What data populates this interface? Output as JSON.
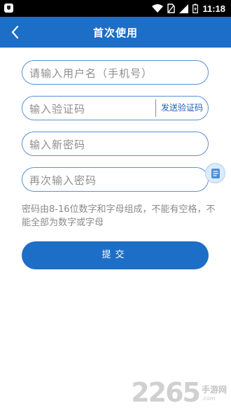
{
  "status_bar": {
    "time": "11:18"
  },
  "header": {
    "title": "首次使用"
  },
  "form": {
    "username_placeholder": "请输入用户名（手机号）",
    "code_placeholder": "输入验证码",
    "send_code_label": "发送验证码",
    "new_password_placeholder": "输入新密码",
    "confirm_password_placeholder": "再次输入密码",
    "hint": "密码由8-16位数字和字母组成，不能有空格，不能全部为数字或字母",
    "submit_label": "提交"
  },
  "watermark": {
    "number": "2265",
    "site": "手游网",
    "domain": ".com"
  },
  "colors": {
    "primary": "#1d6ec6",
    "field_border": "#5b8fd0",
    "placeholder": "#8e8e8e"
  }
}
